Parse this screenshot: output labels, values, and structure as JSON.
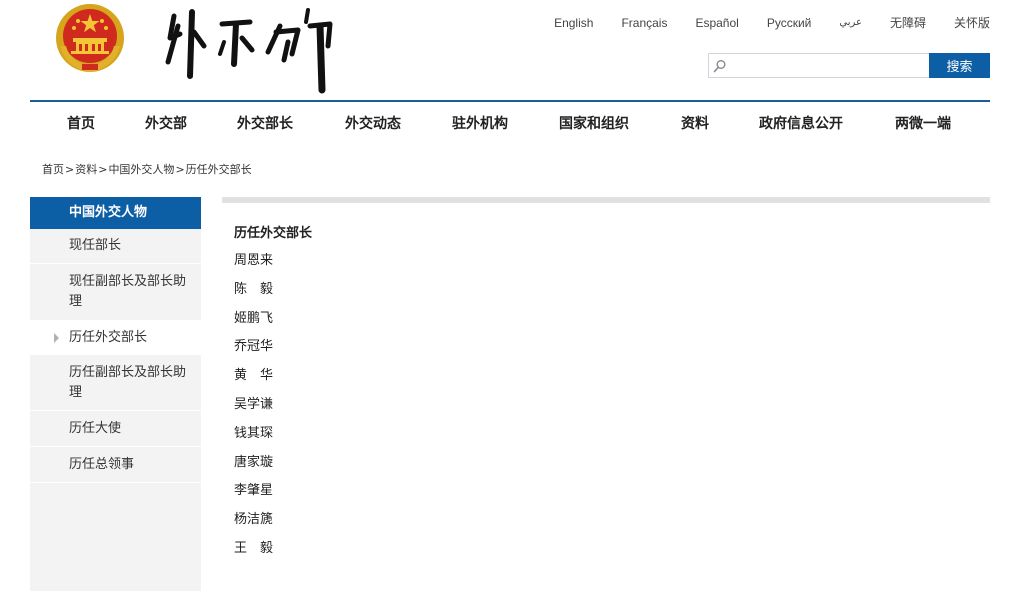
{
  "header": {
    "emblem_icon": "national-emblem-icon",
    "calligraphy_icon": "ministry-calligraphy-logo-icon",
    "languages": [
      "English",
      "Français",
      "Español",
      "Русский",
      "عربي",
      "无障碍",
      "关怀版"
    ],
    "search": {
      "placeholder": "",
      "value": "",
      "button_label": "搜索",
      "icon": "search-icon"
    }
  },
  "nav": {
    "items": [
      "首页",
      "外交部",
      "外交部长",
      "外交动态",
      "驻外机构",
      "国家和组织",
      "资料",
      "政府信息公开",
      "两微一端"
    ]
  },
  "breadcrumb": {
    "items": [
      "首页",
      "资料",
      "中国外交人物",
      "历任外交部长"
    ],
    "separator": ">"
  },
  "sidebar": {
    "title": "中国外交人物",
    "items": [
      {
        "label": "现任部长"
      },
      {
        "label": "现任副部长及部长助理"
      },
      {
        "label": "历任外交部长"
      },
      {
        "label": "历任副部长及部长助理"
      },
      {
        "label": "历任大使"
      },
      {
        "label": "历任总领事"
      }
    ]
  },
  "content": {
    "title": "历任外交部长",
    "ministers": [
      "周恩来",
      "陈　毅",
      "姬鹏飞",
      "乔冠华",
      "黄　华",
      "吴学谦",
      "钱其琛",
      "唐家璇",
      "李肇星",
      "杨洁篪",
      "王　毅"
    ]
  },
  "colors": {
    "brand_blue": "#0d5fa5",
    "rule_blue": "#1d5d97",
    "sidebar_bg": "#f3f3f3",
    "content_bar": "#e1e1e1"
  }
}
